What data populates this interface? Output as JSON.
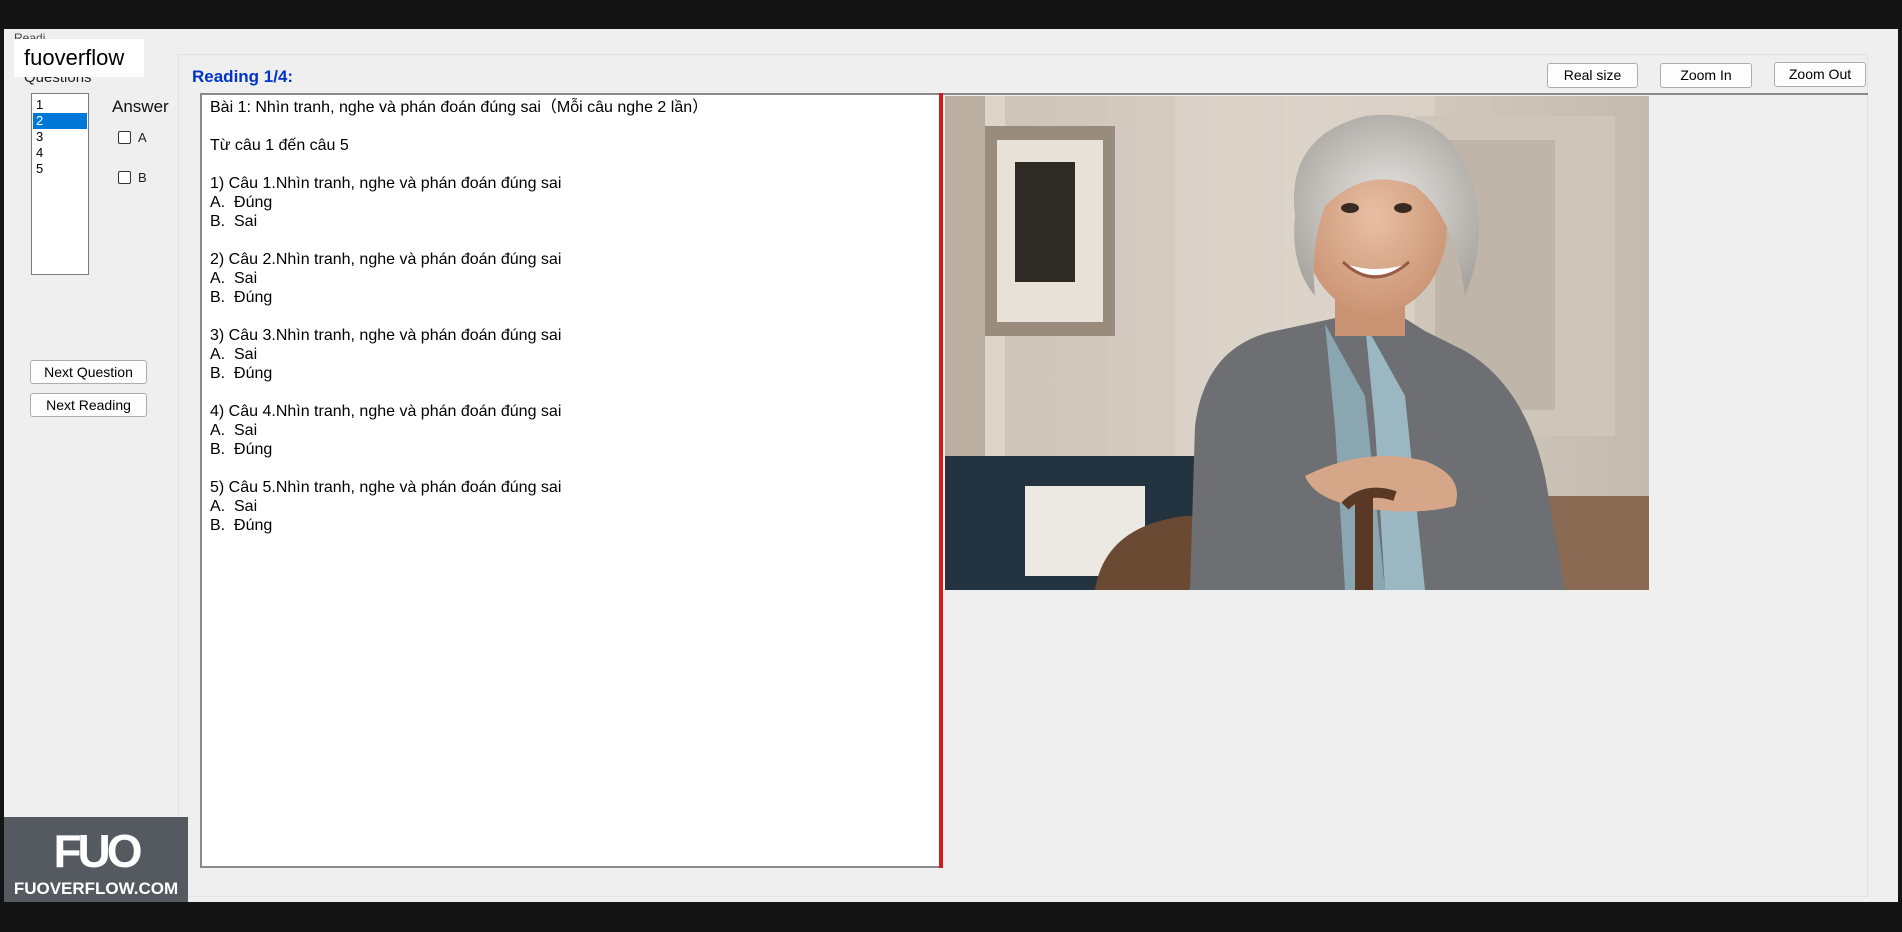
{
  "window": {
    "tab_stub": "Readi",
    "brand_badge": "fuoverflow"
  },
  "sidebar": {
    "questions_label": "Questions",
    "questions": [
      "1",
      "2",
      "3",
      "4",
      "5"
    ],
    "selected_question": "2",
    "answer_label": "Answer",
    "options": [
      {
        "label": "A",
        "checked": false
      },
      {
        "label": "B",
        "checked": false
      }
    ],
    "next_question_button": "Next Question",
    "next_reading_button": "Next Reading"
  },
  "toolbar": {
    "real_size_button": "Real size",
    "zoom_in_button": "Zoom In",
    "zoom_out_button": "Zoom Out"
  },
  "main": {
    "reading_title": "Reading 1/4:",
    "reading_text": "Bài 1: Nhìn tranh, nghe và phán đoán đúng sai（Mỗi câu nghe 2 lần）\n\nTừ câu 1 đến câu 5\n\n1) Câu 1.Nhìn tranh, nghe và phán đoán đúng sai\nA.  Đúng\nB.  Sai\n\n2) Câu 2.Nhìn tranh, nghe và phán đoán đúng sai\nA.  Sai\nB.  Đúng\n\n3) Câu 3.Nhìn tranh, nghe và phán đoán đúng sai\nA.  Sai\nB.  Đúng\n\n4) Câu 4.Nhìn tranh, nghe và phán đoán đúng sai\nA.  Sai\nB.  Đúng\n\n5) Câu 5.Nhìn tranh, nghe và phán đoán đúng sai\nA.  Sai\nB.  Đúng"
  },
  "logo": {
    "mark": "FUO",
    "text": "FUOVERFLOW.COM"
  },
  "colors": {
    "accent_selection": "#0078d7",
    "reading_title": "#0033cc",
    "divider": "#d41a1a",
    "window_bg": "#efefef",
    "outer_bg": "#141414"
  }
}
